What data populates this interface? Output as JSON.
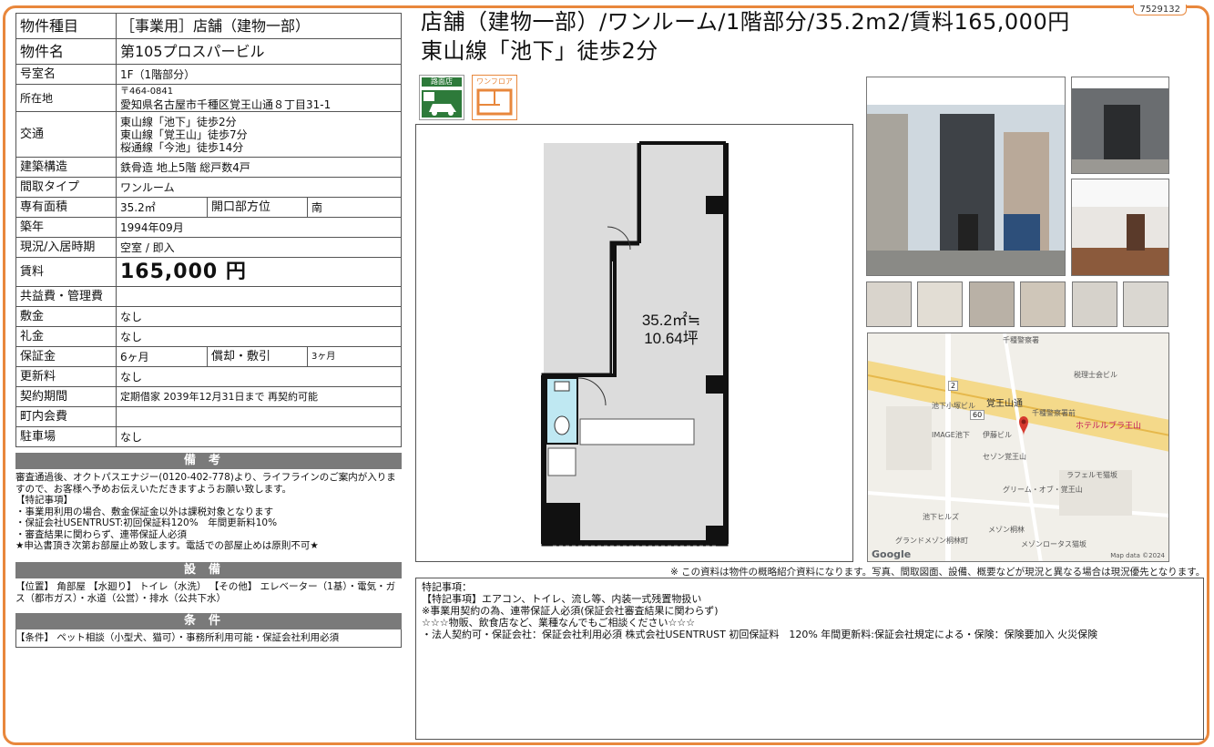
{
  "doc_id": "7529132",
  "title_line1": "店舗（建物一部）/ワンルーム/1階部分/35.2m2/賃料165,000円",
  "title_line2": "東山線「池下」徒歩2分",
  "icons": {
    "roadside": {
      "label": "路面店",
      "icon": "car-icon"
    },
    "onefloor": {
      "label": "ワンフロア",
      "icon": "floor-icon"
    }
  },
  "floorplan": {
    "area_line1": "35.2㎡≒",
    "area_line2": "10.64坪"
  },
  "table": {
    "type_label": "物件種目",
    "type_value": "［事業用］店舗（建物一部）",
    "name_label": "物件名",
    "name_value": "第105プロスパービル",
    "room_label": "号室名",
    "room_value": "1F（1階部分）",
    "addr_label": "所在地",
    "zip": "〒464-0841",
    "addr_value": "愛知県名古屋市千種区覚王山通８丁目31-1",
    "transit_label": "交通",
    "transit_1": "東山線「池下」徒歩2分",
    "transit_2": "東山線「覚王山」徒歩7分",
    "transit_3": "桜通線「今池」徒歩14分",
    "struct_label": "建築構造",
    "struct_value": "鉄骨造 地上5階 総戸数4戸",
    "layout_label": "間取タイプ",
    "layout_value": "ワンルーム",
    "area_label": "専有面積",
    "area_value": "35.2㎡",
    "facing_label": "開口部方位",
    "facing_value": "南",
    "built_label": "築年",
    "built_value": "1994年09月",
    "status_label": "現況/入居時期",
    "status_value": "空室 / 即入",
    "rent_label": "賃料",
    "rent_value": "165,000 円",
    "mgmt_label": "共益費・管理費",
    "mgmt_value": "",
    "deposit_label": "敷金",
    "deposit_value": "なし",
    "keymoney_label": "礼金",
    "keymoney_value": "なし",
    "guarantee_label": "保証金",
    "guarantee_value": "6ヶ月",
    "amort_label": "償却・敷引",
    "amort_value": "3ヶ月",
    "renewal_label": "更新料",
    "renewal_value": "なし",
    "contract_label": "契約期間",
    "contract_value": "定期借家 2039年12月31日まで 再契約可能",
    "town_label": "町内会費",
    "town_value": "",
    "parking_label": "駐車場",
    "parking_value": "なし"
  },
  "sections": {
    "bikou": "備考",
    "setsubi": "設備",
    "jouken": "条件"
  },
  "bikou_text": "審査通過後、オクトパスエナジー(0120-402-778)より、ライフラインのご案内が入りますので、お客様へ予めお伝えいただきますようお願い致します。\n【特記事項】\n・事業用利用の場合、敷金保証金以外は課税対象となります\n・保証会社USENTRUST:初回保証料120%　年間更新料10%\n・審査結果に関わらず、連帯保証人必須\n★申込書頂き次第お部屋止め致します。電話での部屋止めは原則不可★",
  "setsubi_text": "【位置】 角部屋 【水廻り】 トイレ（水洗） 【その他】 エレベーター（1基）・電気・ガス（都市ガス）・水道（公営）・排水（公共下水）",
  "jouken_text": "【条件】 ペット相談（小型犬、猫可）・事務所利用可能・保証会社利用必須",
  "disclaimer": "※ この資料は物件の概略紹介資料になります。写真、間取図面、設備、概要などが現況と異なる場合は現況優先となります。",
  "remarks_text": "特記事項：\n【特記事項】エアコン、トイレ、流し等、内装一式残置物扱い\n※事業用契約の為、連帯保証人必須(保証会社審査結果に関わらず)\n☆☆☆物販、飲食店など、業種なんでもご相談ください☆☆☆\n・法人契約可・保証会社：保証会社利用必須 株式会社USENTRUST 初回保証料　120% 年間更新料:保証会社規定による・保険：保険要加入 火災保険",
  "map": {
    "labels": [
      "千種警察署",
      "税理士会ビル",
      "覚王山通",
      "池下小塚ビル",
      "千種警察署前",
      "ホテルルブラ王山",
      "IMAGE池下",
      "伊藤ビル",
      "セゾン覚王山",
      "ラフェルモ猫坂",
      "グリーム・オブ・覚王山",
      "池下ヒルズ",
      "メゾン桐林",
      "グランドメゾン桐林町",
      "メゾンロータス猫坂"
    ],
    "route_60": "60",
    "route_2": "2",
    "google": "Google",
    "credit": "Map data ©2024"
  }
}
